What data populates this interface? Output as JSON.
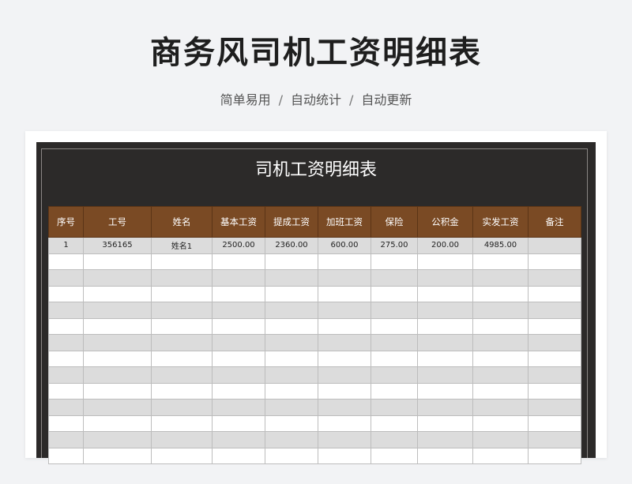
{
  "header": {
    "title": "商务风司机工资明细表",
    "subtitle": [
      "简单易用",
      "自动统计",
      "自动更新"
    ],
    "separator": "/"
  },
  "sheet": {
    "title": "司机工资明细表",
    "columns": [
      "序号",
      "工号",
      "姓名",
      "基本工资",
      "提成工资",
      "加班工资",
      "保险",
      "公积金",
      "实发工资",
      "备注"
    ],
    "rows": [
      [
        "1",
        "356165",
        "姓名1",
        "2500.00",
        "2360.00",
        "600.00",
        "275.00",
        "200.00",
        "4985.00",
        ""
      ]
    ],
    "empty_row_count": 13
  },
  "colors": {
    "header_bg": "#7a4a24",
    "frame_bg": "#2c2a29",
    "stripe": "#dcdcdc"
  }
}
